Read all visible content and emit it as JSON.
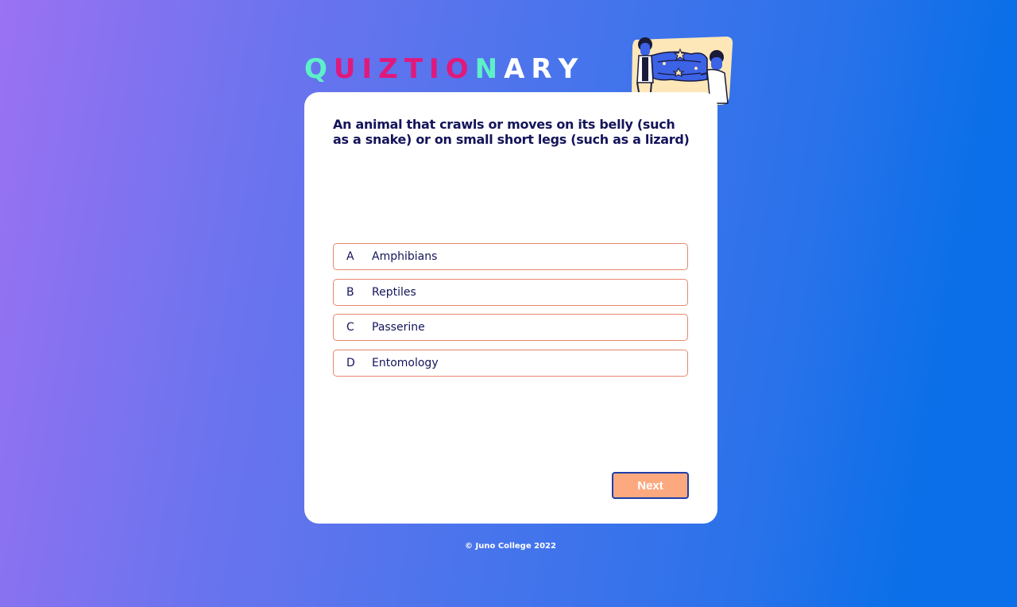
{
  "app": {
    "logo_letters": [
      {
        "char": "Q",
        "color": "#5ef0c8"
      },
      {
        "char": "U",
        "color": "#e0197d"
      },
      {
        "char": "I",
        "color": "#e0197d"
      },
      {
        "char": "Z",
        "color": "#e0197d"
      },
      {
        "char": "T",
        "color": "#e0197d"
      },
      {
        "char": "I",
        "color": "#e0197d"
      },
      {
        "char": "O",
        "color": "#e0197d"
      },
      {
        "char": "N",
        "color": "#5ef0c8"
      },
      {
        "char": "A",
        "color": "#ffffff"
      },
      {
        "char": "R",
        "color": "#ffffff"
      },
      {
        "char": "Y",
        "color": "#ffffff"
      }
    ]
  },
  "illustration": {
    "icon": "two-people-holding-sign-illustration"
  },
  "quiz": {
    "question": "An animal that crawls or moves on its belly (such as a snake) or on small short legs (such as a lizard)",
    "answers": [
      {
        "letter": "A",
        "text": "Amphibians"
      },
      {
        "letter": "B",
        "text": "Reptiles"
      },
      {
        "letter": "C",
        "text": "Passerine"
      },
      {
        "letter": "D",
        "text": "Entomology"
      }
    ],
    "next_label": "Next"
  },
  "footer": {
    "text": "© Juno College 2022"
  },
  "colors": {
    "accent_teal": "#5ef0c8",
    "accent_pink": "#e0197d",
    "answer_border": "#e8866e",
    "button_bg": "#fda980",
    "text_dark": "#14145a"
  }
}
